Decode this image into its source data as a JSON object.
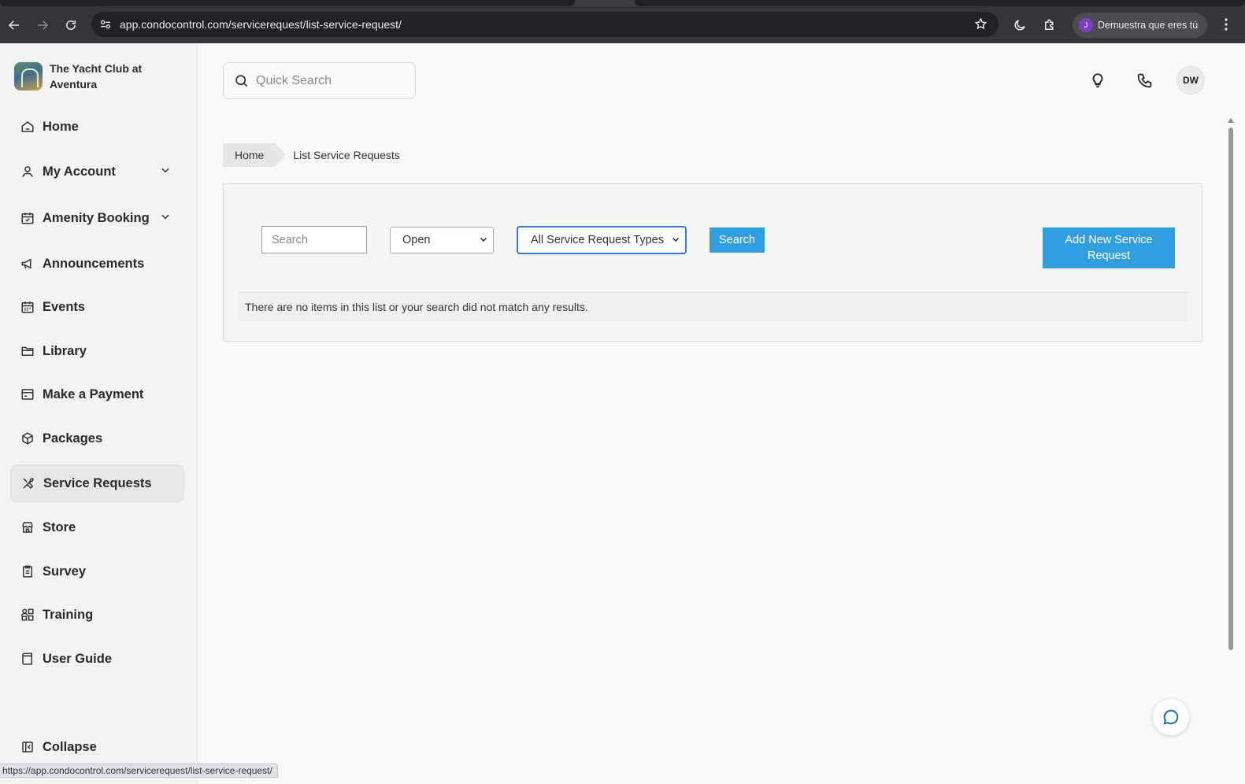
{
  "browser": {
    "url": "app.condocontrol.com/servicerequest/list-service-request/",
    "profile_label": "Demuestra que eres tú",
    "profile_initial": "J"
  },
  "sidebar": {
    "brand_name": "The Yacht Club at Aventura",
    "items": [
      {
        "label": "Home",
        "icon": "home-icon"
      },
      {
        "label": "My Account",
        "icon": "user-icon",
        "expandable": true
      },
      {
        "label": "Amenity Booking",
        "icon": "calendar-check-icon",
        "expandable": true
      },
      {
        "label": "Announcements",
        "icon": "megaphone-icon"
      },
      {
        "label": "Events",
        "icon": "calendar-icon"
      },
      {
        "label": "Library",
        "icon": "folder-icon"
      },
      {
        "label": "Make a Payment",
        "icon": "payment-icon"
      },
      {
        "label": "Packages",
        "icon": "package-icon"
      },
      {
        "label": "Service Requests",
        "icon": "tools-icon",
        "active": true
      },
      {
        "label": "Store",
        "icon": "store-icon"
      },
      {
        "label": "Survey",
        "icon": "clipboard-icon"
      },
      {
        "label": "Training",
        "icon": "training-icon"
      },
      {
        "label": "User Guide",
        "icon": "book-icon"
      }
    ],
    "collapse_label": "Collapse"
  },
  "header": {
    "quick_search_placeholder": "Quick Search",
    "avatar_initials": "DW"
  },
  "breadcrumb": {
    "home": "Home",
    "current": "List Service Requests"
  },
  "filters": {
    "search_placeholder": "Search",
    "status_value": "Open",
    "type_value": "All Service Request Types",
    "search_button": "Search",
    "add_button": "Add New Service Request"
  },
  "results": {
    "empty_message": "There are no items in this list or your search did not match any results."
  },
  "status_bar": {
    "hover_url": "https://app.condocontrol.com/servicerequest/list-service-request/"
  },
  "colors": {
    "accent": "#2f9fe0",
    "chrome": "#35363a"
  }
}
